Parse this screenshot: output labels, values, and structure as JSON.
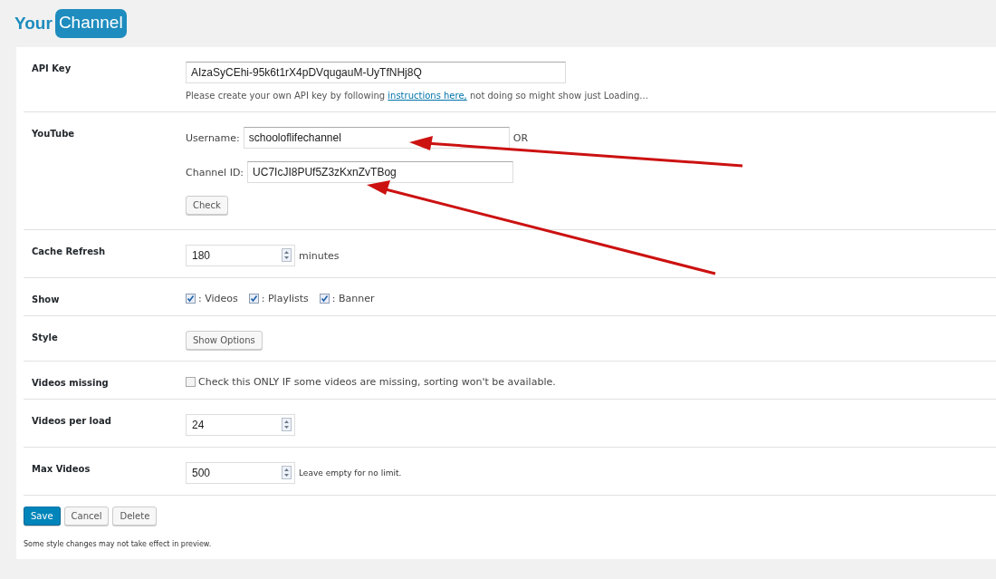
{
  "logo": {
    "word": "Your",
    "badge": "Channel"
  },
  "rows": [
    {
      "kind": "apikey",
      "label": "API Key",
      "value": "AIzaSyCEhi-95k6t1rX4pDVqugauM-UyTfNHj8Q",
      "help_before": "Please create your own API key by following ",
      "help_link": "instructions here,",
      "help_after": " not doing so might show just Loading..."
    },
    {
      "kind": "youtube",
      "label": "YouTube",
      "fields": [
        {
          "label": "Username:",
          "value": "schooloflifechannel",
          "suffix": "OR"
        },
        {
          "label": "Channel ID:",
          "value": "UC7IcJI8PUf5Z3zKxnZvTBog"
        }
      ],
      "button": "Check"
    },
    {
      "kind": "number",
      "label": "Cache Refresh",
      "value": "180",
      "unit": "minutes"
    },
    {
      "kind": "checkboxes",
      "label": "Show",
      "options": [
        {
          "label": ": Videos",
          "checked": true
        },
        {
          "label": ": Playlists",
          "checked": true
        },
        {
          "label": ": Banner",
          "checked": true
        }
      ]
    },
    {
      "kind": "button",
      "label": "Style",
      "button": "Show Options"
    },
    {
      "kind": "checkbox",
      "label": "Videos missing",
      "text": "Check this ONLY IF some videos are missing, sorting won't be available.",
      "checked": false
    },
    {
      "kind": "number",
      "label": "Videos per load",
      "value": "24"
    },
    {
      "kind": "number",
      "label": "Max Videos",
      "value": "500",
      "note": "Leave empty for no limit."
    }
  ],
  "actions": [
    {
      "label": "Save",
      "kind": "primary"
    },
    {
      "label": "Cancel",
      "kind": "secondary"
    },
    {
      "label": "Delete",
      "kind": "secondary"
    }
  ],
  "footer_note": "Some style changes may not take effect in preview."
}
